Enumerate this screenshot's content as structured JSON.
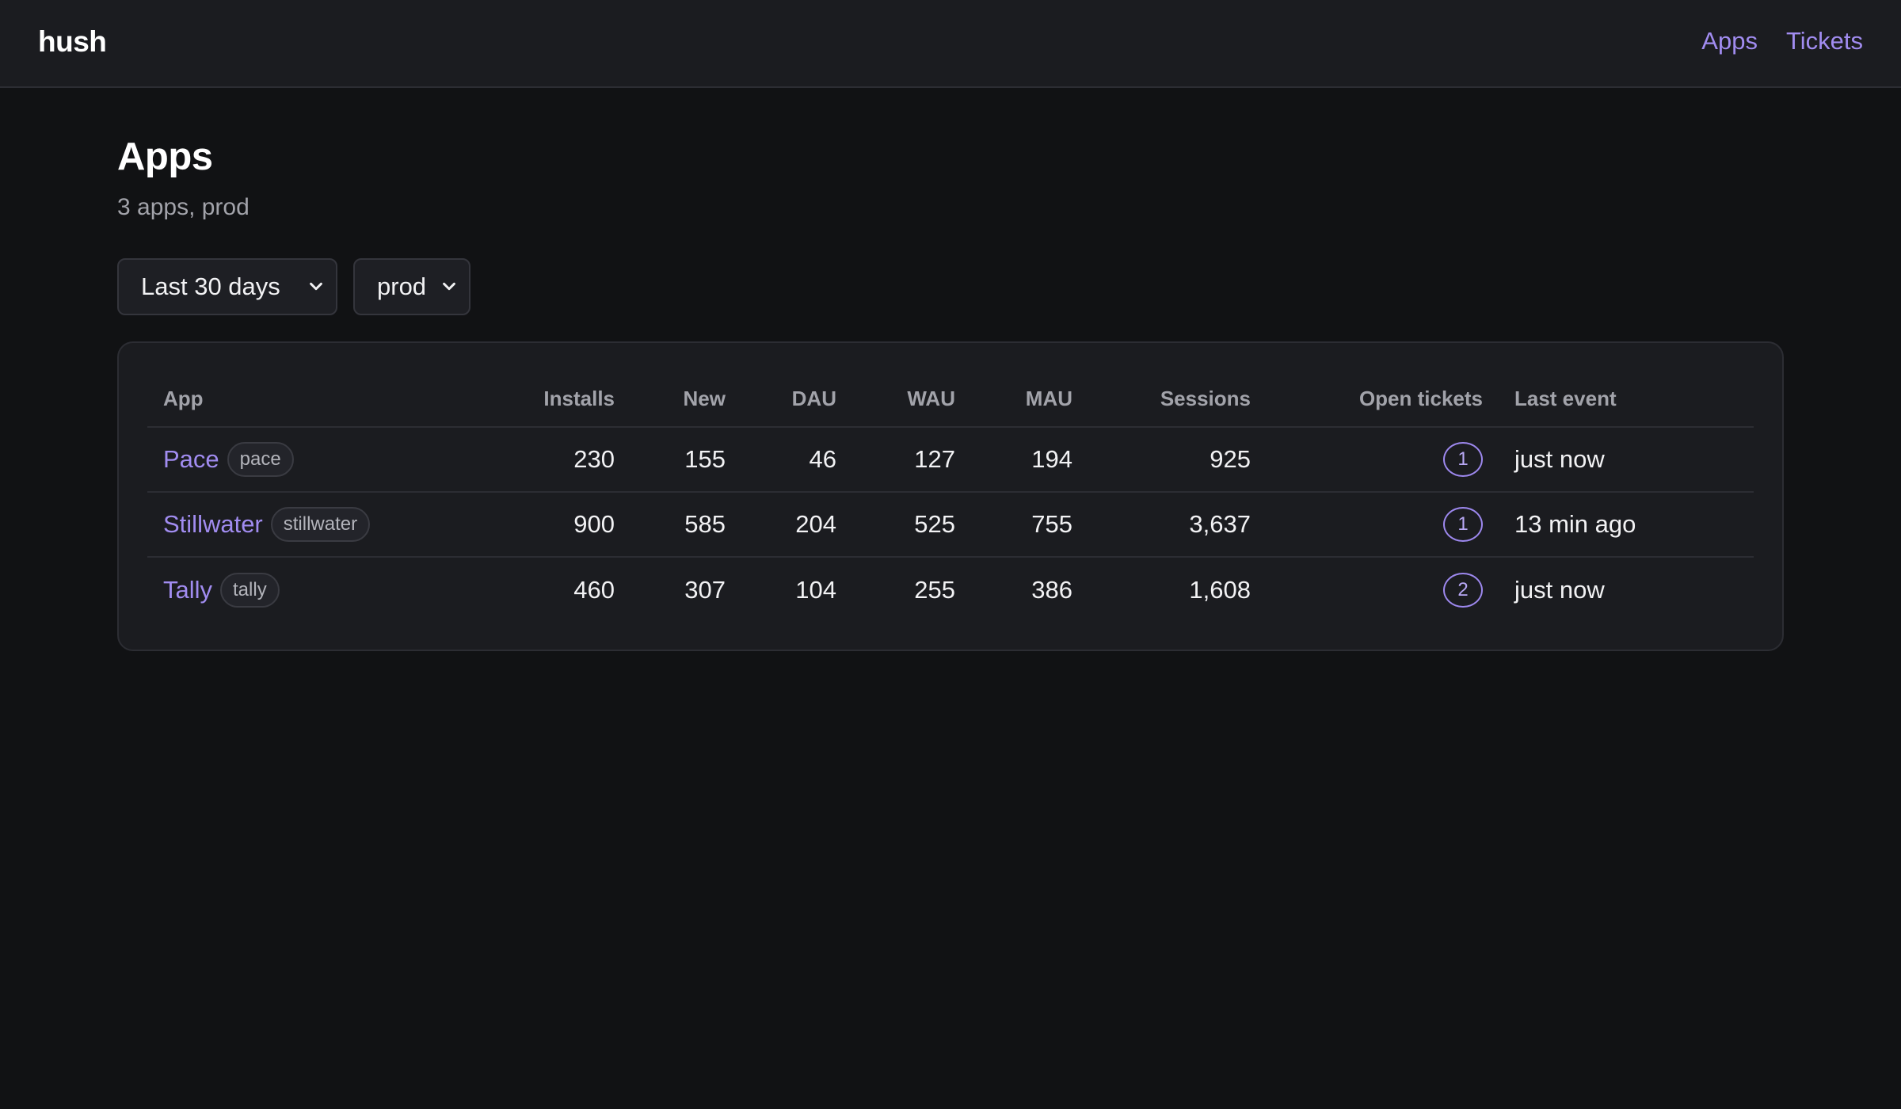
{
  "header": {
    "brand": "hush",
    "nav": [
      {
        "label": "Apps"
      },
      {
        "label": "Tickets"
      }
    ]
  },
  "page": {
    "title": "Apps",
    "subtitle": "3 apps, prod"
  },
  "filters": {
    "range": "Last 30 days",
    "env": "prod"
  },
  "table": {
    "columns": [
      "App",
      "Installs",
      "New",
      "DAU",
      "WAU",
      "MAU",
      "Sessions",
      "Open tickets",
      "Last event"
    ],
    "rows": [
      {
        "name": "Pace",
        "slug": "pace",
        "installs": "230",
        "new": "155",
        "dau": "46",
        "wau": "127",
        "mau": "194",
        "sessions": "925",
        "tickets": "1",
        "last_event": "just now"
      },
      {
        "name": "Stillwater",
        "slug": "stillwater",
        "installs": "900",
        "new": "585",
        "dau": "204",
        "wau": "525",
        "mau": "755",
        "sessions": "3,637",
        "tickets": "1",
        "last_event": "13 min ago"
      },
      {
        "name": "Tally",
        "slug": "tally",
        "installs": "460",
        "new": "307",
        "dau": "104",
        "wau": "255",
        "mau": "386",
        "sessions": "1,608",
        "tickets": "2",
        "last_event": "just now"
      }
    ]
  },
  "colors": {
    "accent": "#a18cf0",
    "background": "#111214",
    "surface": "#1b1c20"
  }
}
